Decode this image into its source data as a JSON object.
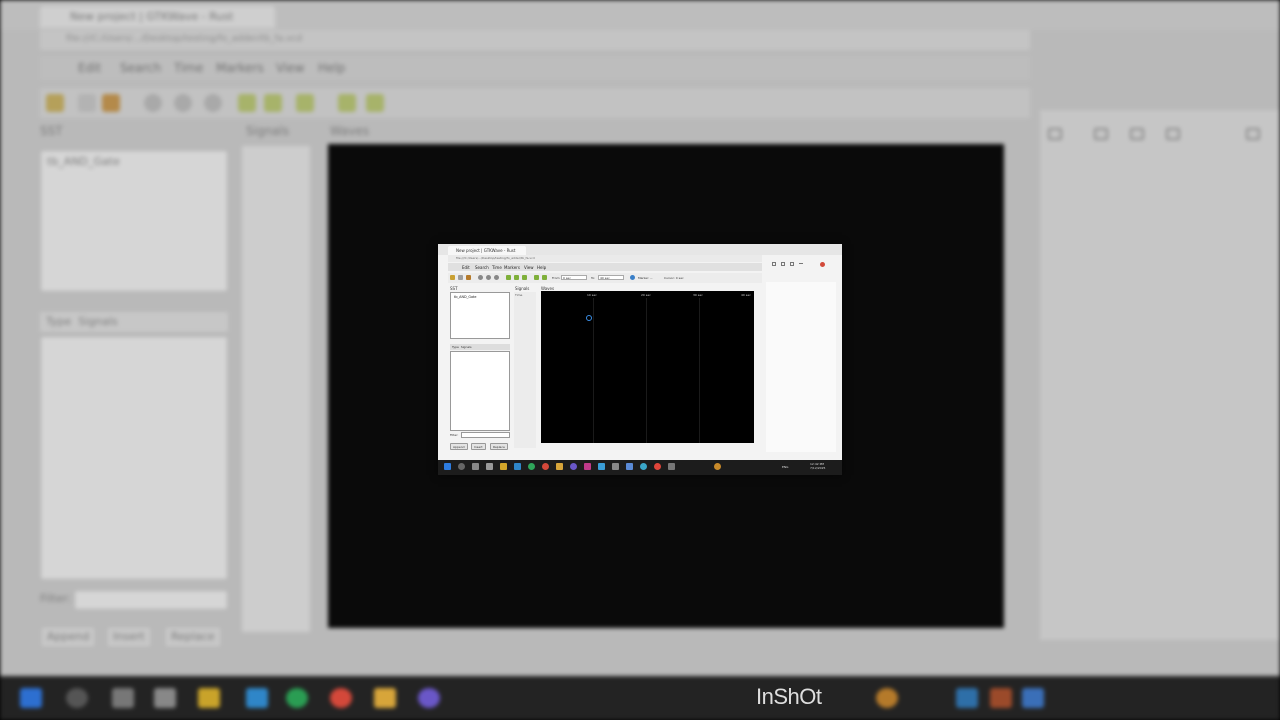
{
  "browser": {
    "tab_title": "New project | GTKWave - Rust",
    "url": "file:///C:/Users/.../Desktop/testing/fo_adder/tb_fa.vcd"
  },
  "app": {
    "menu": [
      "Edit",
      "Search",
      "Time",
      "Markers",
      "View",
      "Help"
    ],
    "toolbar_from_label": "From:",
    "toolbar_from_value": "0 sec",
    "toolbar_to_label": "To:",
    "toolbar_to_value": "40 sec",
    "toolbar_marker_label": "Marker: --",
    "toolbar_cursor_label": "Cursor: 0 sec"
  },
  "sst": {
    "header": "SST",
    "items": [
      "tb_AND_Gate"
    ]
  },
  "type_list": {
    "type_header": "Type",
    "signals_header": "Signals"
  },
  "filter": {
    "label": "Filter:",
    "value": ""
  },
  "actions": {
    "append": "Append",
    "insert": "Insert",
    "replace": "Replace"
  },
  "signals_pane": {
    "header": "Signals",
    "time_label": "Time"
  },
  "waves_pane": {
    "header": "Waves",
    "ticks": [
      "10 sec",
      "20 sec",
      "30 sec",
      "40 sec"
    ]
  },
  "taskbar": {
    "language": "ENG",
    "time": "12:42 PM",
    "date": "7/12/2025"
  },
  "watermark": "InShOt",
  "colors": {
    "wave_background": "#000000",
    "cursor_ring": "#3a8ee6",
    "taskbar": "#1c1c1c"
  }
}
